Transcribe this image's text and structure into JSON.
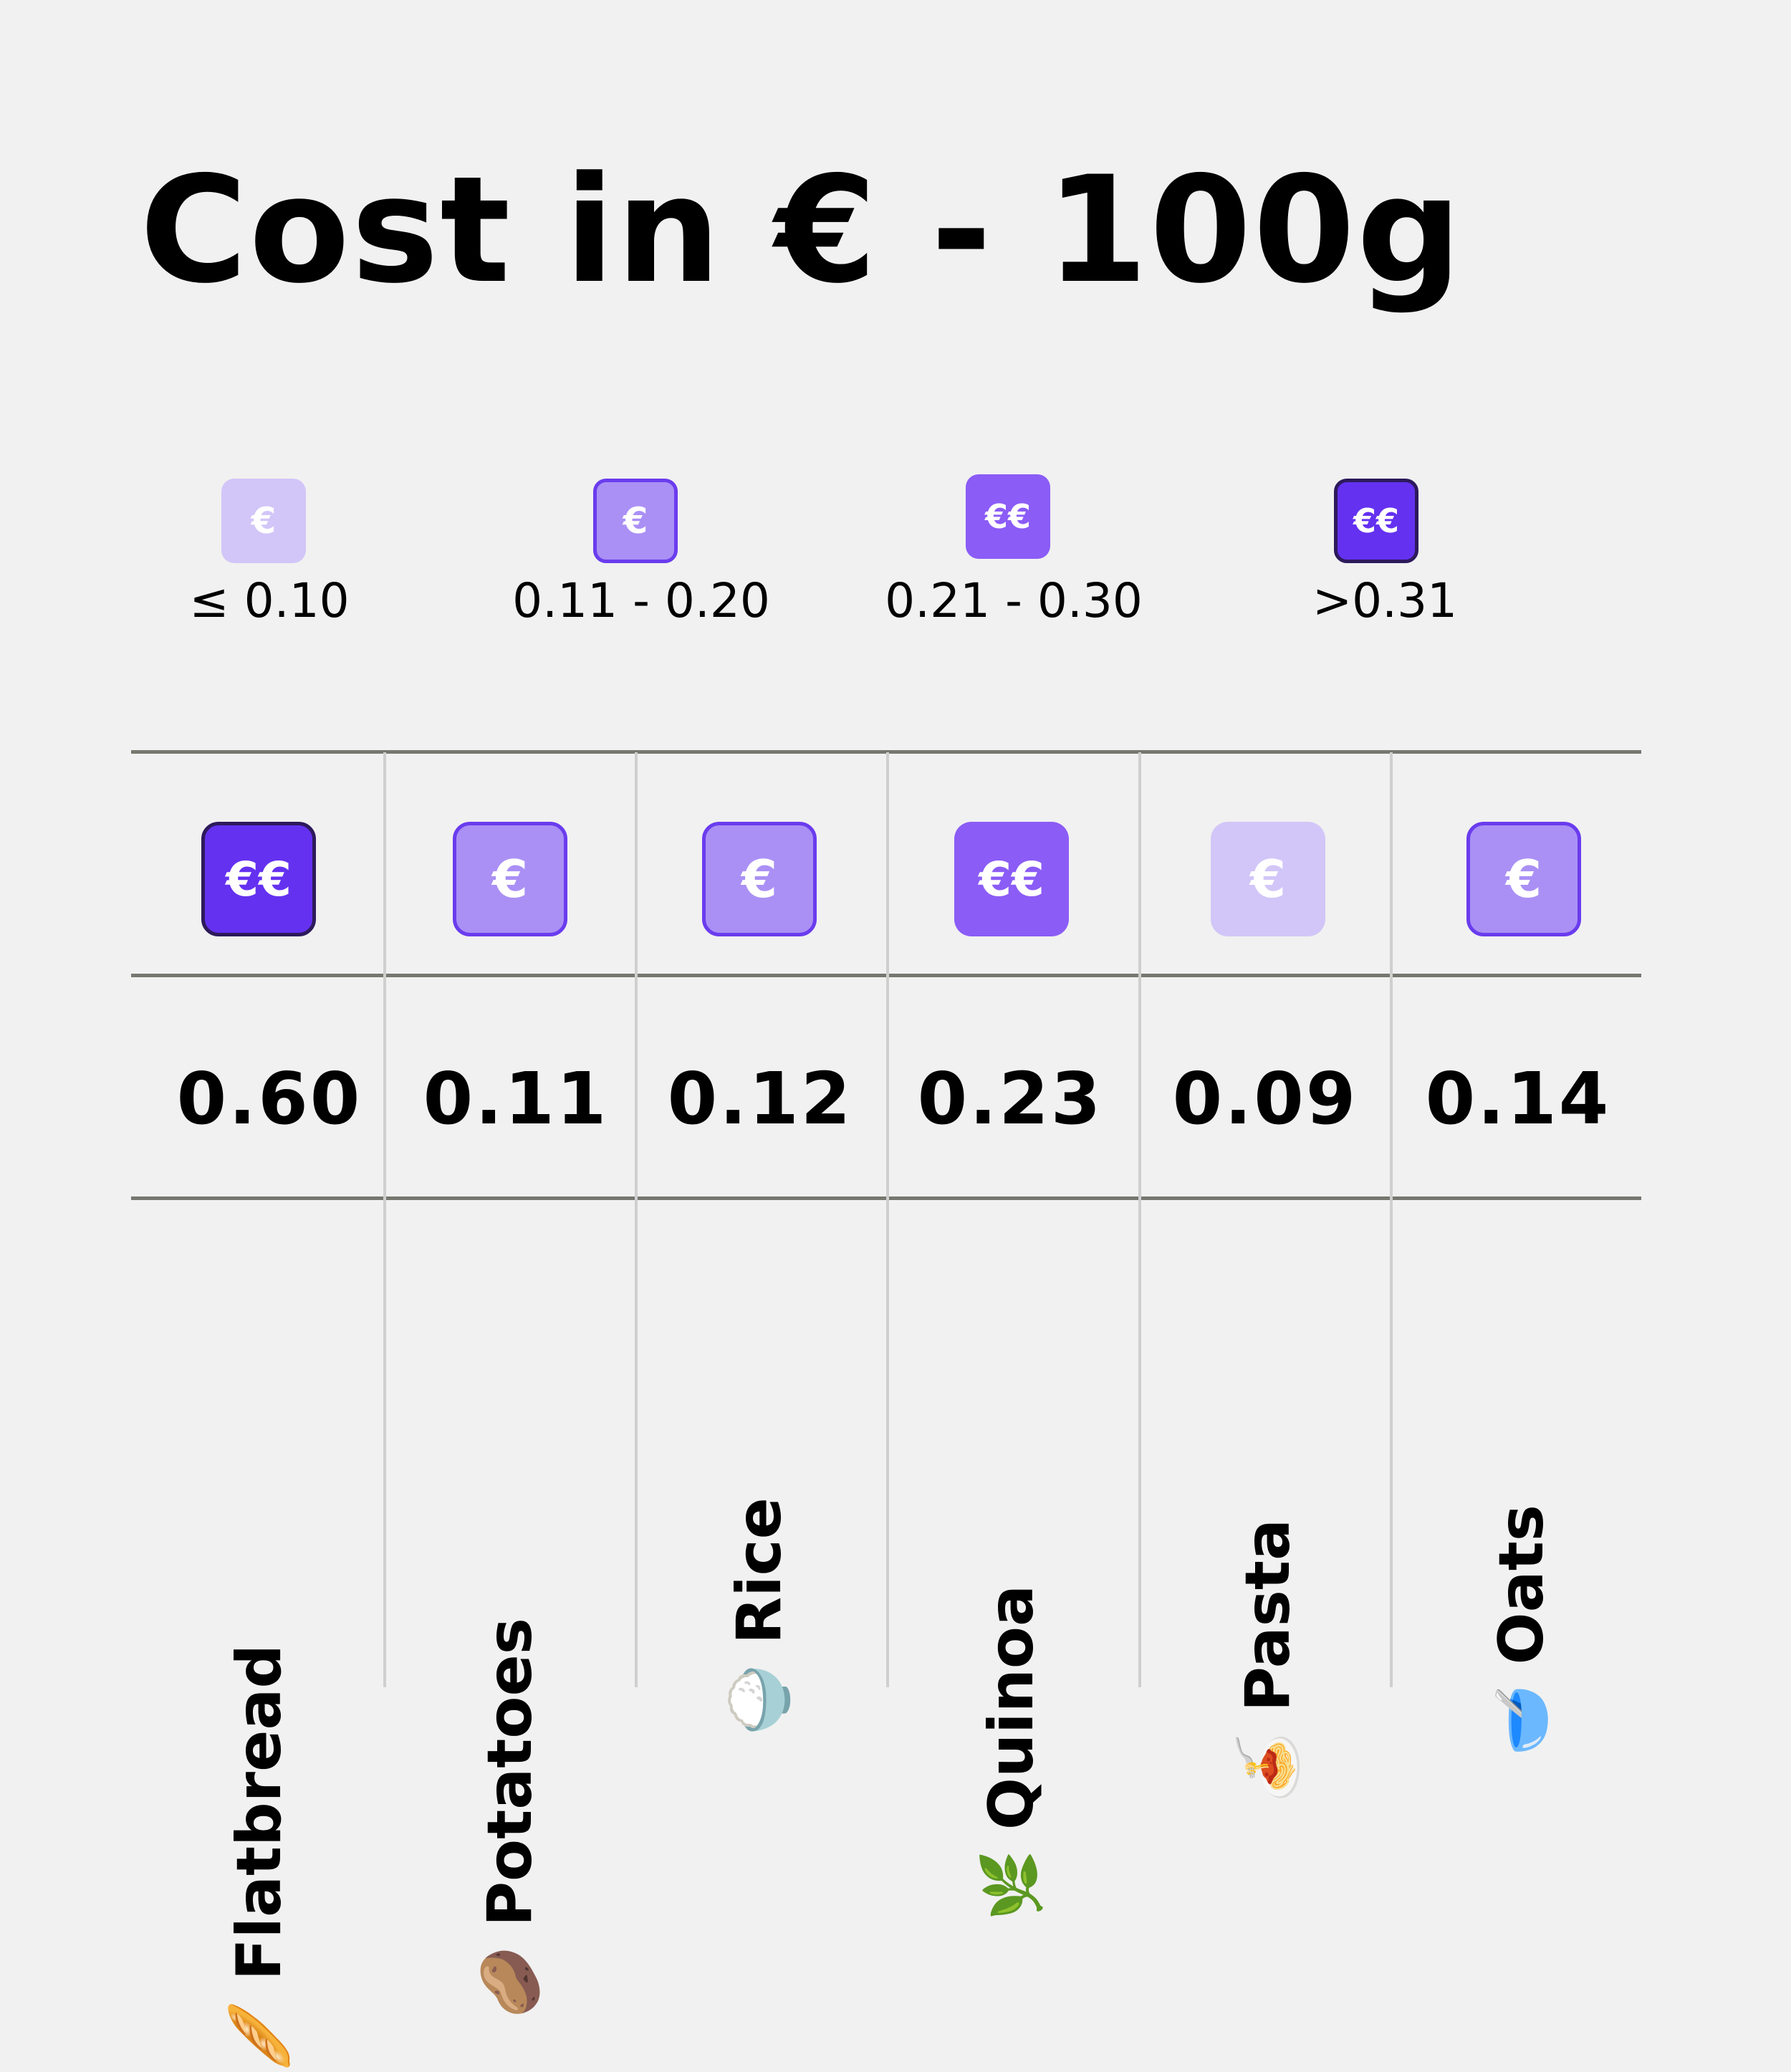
{
  "title": "Cost in € - 100g",
  "legend": [
    {
      "symbol": "€",
      "label": "≤ 0.10"
    },
    {
      "symbol": "€",
      "label": "0.11 - 0.20"
    },
    {
      "symbol": "€€",
      "label": "0.21 - 0.30"
    },
    {
      "symbol": "€€",
      "label": ">0.31"
    }
  ],
  "foods": [
    {
      "name": "Flatbread",
      "emoji": "🥖",
      "symbol": "€€",
      "value": "0.60"
    },
    {
      "name": "Potatoes",
      "emoji": "🥔",
      "symbol": "€",
      "value": "0.11"
    },
    {
      "name": "Rice",
      "emoji": "🍚",
      "symbol": "€",
      "value": "0.12"
    },
    {
      "name": "Quinoa",
      "emoji": "🌿",
      "symbol": "€€",
      "value": "0.23"
    },
    {
      "name": "Pasta",
      "emoji": "🍝",
      "symbol": "€",
      "value": "0.09"
    },
    {
      "name": "Oats",
      "emoji": "🥣",
      "symbol": "€",
      "value": "0.14"
    }
  ],
  "colors": {
    "tier1": "#d2c6f8",
    "tier2": "#aa90f5",
    "tier3": "#8b5cf6",
    "tier4": "#6431f0",
    "background": "#f1f1f1"
  }
}
